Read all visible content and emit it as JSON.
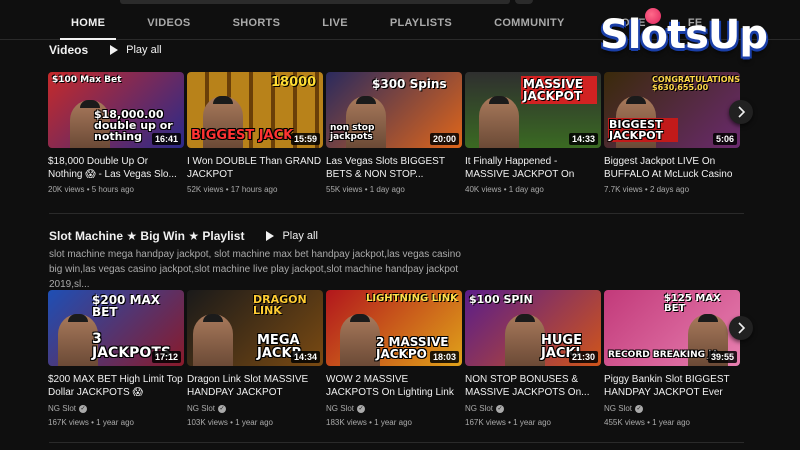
{
  "tabs": [
    "HOME",
    "VIDEOS",
    "SHORTS",
    "LIVE",
    "PLAYLISTS",
    "COMMUNITY",
    "STORE",
    "FE"
  ],
  "logo_text": "SlotsUp",
  "sections": [
    {
      "title": "Videos",
      "play_all": "Play all",
      "videos": [
        {
          "title": "$18,000 Double Up Or Nothing 😱 - Las Vegas Slo...",
          "views": "20K views",
          "age": "5 hours ago",
          "duration": "16:41",
          "top": "$100 Max Bet",
          "big": "$18,000.00 double up or nothing",
          "bg": "#c62a2a"
        },
        {
          "title": "I Won DOUBLE Than GRAND JACKPOT",
          "views": "52K views",
          "age": "17 hours ago",
          "duration": "15:59",
          "top": "18000",
          "big": "BIGGEST JACK",
          "bg": "#8a5a10"
        },
        {
          "title": "Las Vegas Slots BIGGEST BETS & NON STOP...",
          "views": "55K views",
          "age": "1 day ago",
          "duration": "20:00",
          "top": "$300 Spins",
          "big": "non stop jackpots",
          "bg": "#b3470d"
        },
        {
          "title": "It Finally Happened - MASSIVE JACKPOT On Huff...",
          "views": "40K views",
          "age": "1 day ago",
          "duration": "14:33",
          "top": "MASSIVE JACKPOT",
          "big": "",
          "bg": "#3a6a22"
        },
        {
          "title": "Biggest Jackpot LIVE On BUFFALO At McLuck Casino",
          "views": "7.7K views",
          "age": "2 days ago",
          "duration": "5:06",
          "top": "CONGRATULATIONS $630,655.00",
          "big": "BIGGEST JACKPOT",
          "bg": "#6a2a6e"
        }
      ]
    },
    {
      "title": "Slot Machine ★ Big Win ★ Playlist",
      "play_all": "Play all",
      "description": "slot machine mega handpay jackpot, slot machine max bet handpay jackpot,las vegas casino big win,las vegas casino jackpot,slot machine live play jackpot,slot machine handpay jackpot 2019,sl...",
      "videos": [
        {
          "title": "$200 MAX BET High Limit Top Dollar JACKPOTS 😱",
          "channel": "NG Slot",
          "views": "167K views",
          "age": "1 year ago",
          "duration": "17:12",
          "top": "$200 MAX BET",
          "big": "3 JACKPOTS",
          "bg": "#1e4fb5"
        },
        {
          "title": "Dragon Link Slot MASSIVE HANDPAY JACKPOT",
          "channel": "NG Slot",
          "views": "103K views",
          "age": "1 year ago",
          "duration": "14:34",
          "top": "DRAGON LINK",
          "big": "MEGA JACKP",
          "bg": "#7a4a12"
        },
        {
          "title": "WOW 2 MASSIVE JACKPOTS On Lighting Link Slot...",
          "channel": "NG Slot",
          "views": "183K views",
          "age": "1 year ago",
          "duration": "18:03",
          "top": "LIGHTNING LINK",
          "big": "2 MASSIVE JACKPO",
          "bg": "#b2161c"
        },
        {
          "title": "NON STOP BONUSES & MASSIVE JACKPOTS On...",
          "channel": "NG Slot",
          "views": "167K views",
          "age": "1 year ago",
          "duration": "21:30",
          "top": "$100 SPIN",
          "big": "HUGE JACKI",
          "bg": "#5a1d8a"
        },
        {
          "title": "Piggy Bankin Slot BIGGEST HANDPAY JACKPOT Ever O...",
          "channel": "NG Slot",
          "views": "455K views",
          "age": "1 year ago",
          "duration": "39:55",
          "top": "$125 MAX BET",
          "big": "RECORD BREAKING JA",
          "bg": "#c23a7a"
        }
      ]
    }
  ],
  "colors": {
    "background": "#0f0f0f",
    "text": "#f1f1f1",
    "secondary": "#aaaaaa",
    "logo_blue": "#1a3fa8"
  }
}
